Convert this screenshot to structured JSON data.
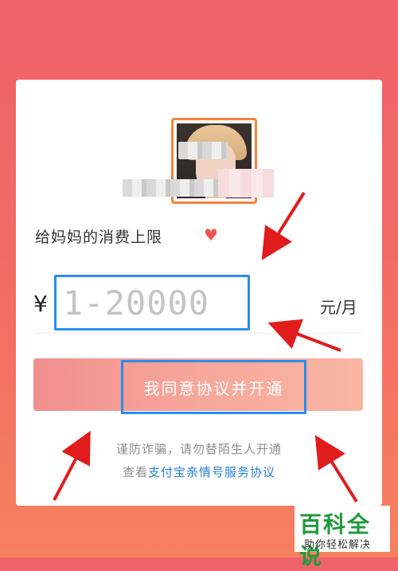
{
  "profile": {
    "name": "",
    "subtitle": ""
  },
  "limit": {
    "label": "给妈妈的消费上限",
    "heart_icon": "heart-icon",
    "heart_color": "#f0554f"
  },
  "amount": {
    "currency": "¥",
    "value": "",
    "placeholder": "1-20000",
    "unit": "元/月"
  },
  "agree_button": {
    "label": "我同意协议并开通"
  },
  "notice": {
    "warning": "谨防诈骗，请勿替陌生人开通",
    "agreement_prefix": "查看",
    "agreement_link": "支付宝亲情号服务协议"
  },
  "watermark": {
    "title": "百科全说",
    "subtitle": "助你轻松解决",
    "color": "#1f9a3c"
  },
  "colors": {
    "accent_blue": "#2a8cf0",
    "arrow_red": "#e11c1c",
    "avatar_border": "#f5843a"
  }
}
